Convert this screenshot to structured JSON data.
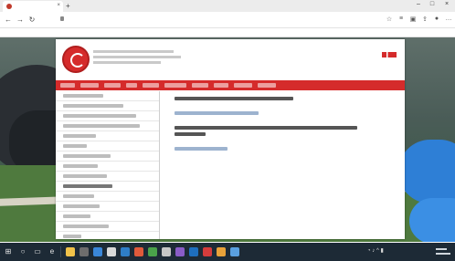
{
  "browser": {
    "tab_title": "",
    "address": "",
    "notice": ""
  },
  "site": {
    "org_lines": [
      "",
      "",
      ""
    ],
    "menu": [
      "",
      "",
      "",
      "",
      "",
      "",
      "",
      "",
      "",
      ""
    ],
    "sidebar": [
      "",
      "",
      "",
      "",
      "",
      "",
      "",
      "",
      "",
      "",
      "",
      "",
      "",
      "",
      ""
    ],
    "sidebar_active_index": 9,
    "content_blocks": [
      {
        "kind": "heading",
        "text": ""
      },
      {
        "kind": "link",
        "text": ""
      },
      {
        "kind": "heading",
        "text": ""
      },
      {
        "kind": "heading",
        "text": ""
      },
      {
        "kind": "link",
        "text": ""
      }
    ]
  },
  "colors": {
    "menu_red": "#d52b2b",
    "taskbar": "#1d2a36"
  },
  "icons": {
    "browser_nav": [
      "back-icon",
      "forward-icon",
      "refresh-icon"
    ],
    "browser_right": [
      "favorites-star-icon",
      "reading-list-icon",
      "collections-icon",
      "share-icon",
      "profile-icon",
      "more-icon"
    ],
    "taskbar": [
      "start-icon",
      "search-icon",
      "task-view-icon",
      "edge-icon",
      "file-explorer-icon",
      "store-icon",
      "mail-icon",
      "calendar-icon",
      "photos-icon",
      "settings-icon",
      "app-icon",
      "app-icon",
      "app-icon",
      "app-icon",
      "app-icon",
      "app-icon",
      "app-icon"
    ]
  }
}
